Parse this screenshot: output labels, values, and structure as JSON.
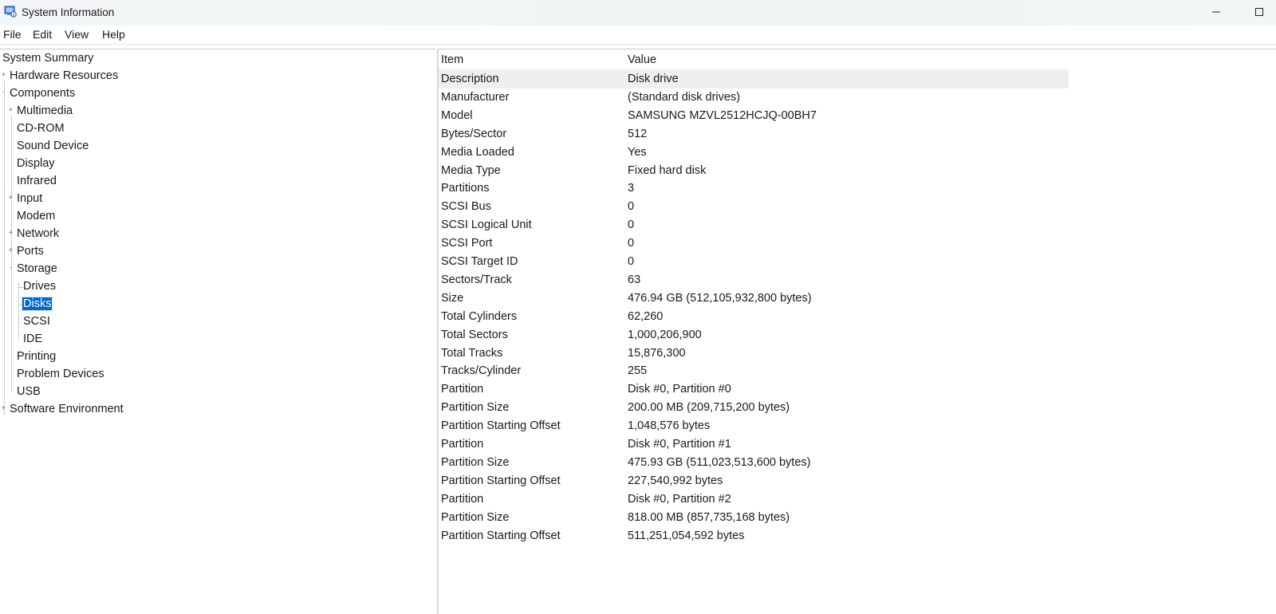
{
  "window": {
    "title": "System Information"
  },
  "menu": [
    "File",
    "Edit",
    "View",
    "Help"
  ],
  "tree": [
    {
      "label": "System Summary",
      "level": 0,
      "expander": "",
      "selected": false
    },
    {
      "label": "Hardware Resources",
      "level": 0,
      "expander": "+",
      "selected": false
    },
    {
      "label": "Components",
      "level": 0,
      "expander": "-",
      "selected": false
    },
    {
      "label": "Multimedia",
      "level": 1,
      "expander": "+",
      "selected": false
    },
    {
      "label": "CD-ROM",
      "level": 1,
      "expander": "",
      "selected": false
    },
    {
      "label": "Sound Device",
      "level": 1,
      "expander": "",
      "selected": false
    },
    {
      "label": "Display",
      "level": 1,
      "expander": "",
      "selected": false
    },
    {
      "label": "Infrared",
      "level": 1,
      "expander": "",
      "selected": false
    },
    {
      "label": "Input",
      "level": 1,
      "expander": "+",
      "selected": false
    },
    {
      "label": "Modem",
      "level": 1,
      "expander": "",
      "selected": false
    },
    {
      "label": "Network",
      "level": 1,
      "expander": "+",
      "selected": false
    },
    {
      "label": "Ports",
      "level": 1,
      "expander": "+",
      "selected": false
    },
    {
      "label": "Storage",
      "level": 1,
      "expander": "-",
      "selected": false
    },
    {
      "label": "Drives",
      "level": 2,
      "expander": "",
      "selected": false
    },
    {
      "label": "Disks",
      "level": 2,
      "expander": "",
      "selected": true
    },
    {
      "label": "SCSI",
      "level": 2,
      "expander": "",
      "selected": false
    },
    {
      "label": "IDE",
      "level": 2,
      "expander": "",
      "selected": false
    },
    {
      "label": "Printing",
      "level": 1,
      "expander": "",
      "selected": false
    },
    {
      "label": "Problem Devices",
      "level": 1,
      "expander": "",
      "selected": false
    },
    {
      "label": "USB",
      "level": 1,
      "expander": "",
      "selected": false
    },
    {
      "label": "Software Environment",
      "level": 0,
      "expander": "+",
      "selected": false
    }
  ],
  "table": {
    "headers": {
      "item": "Item",
      "value": "Value"
    },
    "rows": [
      {
        "item": "Description",
        "value": "Disk drive"
      },
      {
        "item": "Manufacturer",
        "value": "(Standard disk drives)"
      },
      {
        "item": "Model",
        "value": "SAMSUNG MZVL2512HCJQ-00BH7"
      },
      {
        "item": "Bytes/Sector",
        "value": "512"
      },
      {
        "item": "Media Loaded",
        "value": "Yes"
      },
      {
        "item": "Media Type",
        "value": "Fixed hard disk"
      },
      {
        "item": "Partitions",
        "value": "3"
      },
      {
        "item": "SCSI Bus",
        "value": "0"
      },
      {
        "item": "SCSI Logical Unit",
        "value": "0"
      },
      {
        "item": "SCSI Port",
        "value": "0"
      },
      {
        "item": "SCSI Target ID",
        "value": "0"
      },
      {
        "item": "Sectors/Track",
        "value": "63"
      },
      {
        "item": "Size",
        "value": "476.94 GB (512,105,932,800 bytes)"
      },
      {
        "item": "Total Cylinders",
        "value": "62,260"
      },
      {
        "item": "Total Sectors",
        "value": "1,000,206,900"
      },
      {
        "item": "Total Tracks",
        "value": "15,876,300"
      },
      {
        "item": "Tracks/Cylinder",
        "value": "255"
      },
      {
        "item": "Partition",
        "value": "Disk #0, Partition #0"
      },
      {
        "item": "Partition Size",
        "value": "200.00 MB (209,715,200 bytes)"
      },
      {
        "item": "Partition Starting Offset",
        "value": "1,048,576 bytes"
      },
      {
        "item": "Partition",
        "value": "Disk #0, Partition #1"
      },
      {
        "item": "Partition Size",
        "value": "475.93 GB (511,023,513,600 bytes)"
      },
      {
        "item": "Partition Starting Offset",
        "value": "227,540,992 bytes"
      },
      {
        "item": "Partition",
        "value": "Disk #0, Partition #2"
      },
      {
        "item": "Partition Size",
        "value": "818.00 MB (857,735,168 bytes)"
      },
      {
        "item": "Partition Starting Offset",
        "value": "511,251,054,592 bytes"
      }
    ]
  }
}
